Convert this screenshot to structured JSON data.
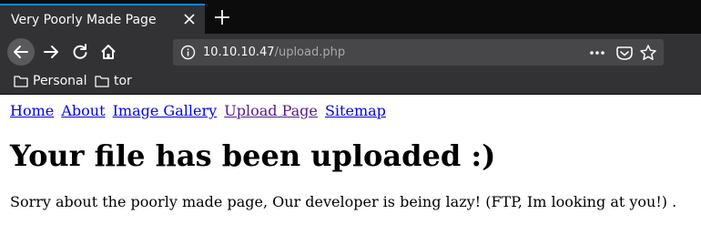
{
  "browser": {
    "tab": {
      "title": "Very Poorly Made Page"
    },
    "address_bar": {
      "host": "10.10.10.47",
      "path": "/upload.php"
    },
    "bookmarks": [
      {
        "label": "Personal",
        "icon": "folder-icon"
      },
      {
        "label": "tor",
        "icon": "folder-icon"
      }
    ],
    "accent_color": "#0a84ff"
  },
  "page": {
    "nav_links": [
      {
        "label": "Home"
      },
      {
        "label": "About"
      },
      {
        "label": "Image Gallery"
      },
      {
        "label": "Upload Page",
        "visited": true
      },
      {
        "label": "Sitemap"
      }
    ],
    "heading": "Your file has been uploaded :)",
    "message": "Sorry about the poorly made page, Our developer is being lazy! (FTP, Im looking at you!) ."
  }
}
